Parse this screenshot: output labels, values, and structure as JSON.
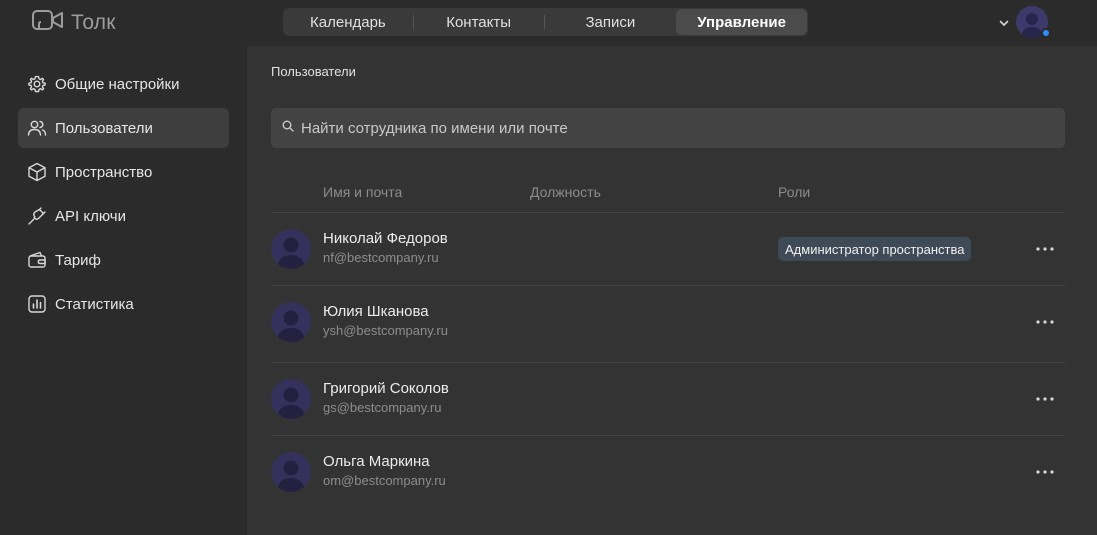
{
  "app": {
    "name": "Толк"
  },
  "nav": {
    "tabs": [
      {
        "label": "Календарь",
        "active": false
      },
      {
        "label": "Контакты",
        "active": false
      },
      {
        "label": "Записи",
        "active": false
      },
      {
        "label": "Управление",
        "active": true
      }
    ]
  },
  "sidebar": {
    "items": [
      {
        "label": "Общие настройки",
        "icon": "gear-icon",
        "active": false
      },
      {
        "label": "Пользователи",
        "icon": "users-icon",
        "active": true
      },
      {
        "label": "Пространство",
        "icon": "cube-icon",
        "active": false
      },
      {
        "label": "API ключи",
        "icon": "plug-icon",
        "active": false
      },
      {
        "label": "Тариф",
        "icon": "wallet-icon",
        "active": false
      },
      {
        "label": "Статистика",
        "icon": "chart-icon",
        "active": false
      }
    ]
  },
  "main": {
    "breadcrumb": "Пользователи",
    "search": {
      "placeholder": "Найти сотрудника по имени или почте"
    },
    "columns": [
      "Имя и почта",
      "Должность",
      "Роли"
    ],
    "users": [
      {
        "name": "Николай Федоров",
        "email": "nf@bestcompany.ru",
        "role": "Администратор пространства"
      },
      {
        "name": "Юлия Шканова",
        "email": "ysh@bestcompany.ru",
        "role": ""
      },
      {
        "name": "Григорий Соколов",
        "email": "gs@bestcompany.ru",
        "role": ""
      },
      {
        "name": "Ольга Маркина",
        "email": "om@bestcompany.ru",
        "role": ""
      }
    ]
  },
  "colors": {
    "accent_online": "#2f8cff",
    "avatar_bg": "#34325c",
    "role_badge_bg": "#3f4a57"
  }
}
